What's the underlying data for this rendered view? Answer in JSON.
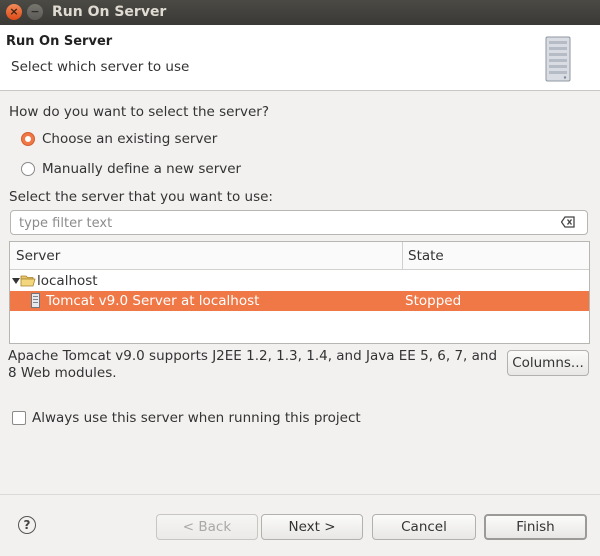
{
  "window": {
    "title": "Run On Server",
    "close_icon": "close-icon",
    "minimize_icon": "minimize-icon"
  },
  "header": {
    "title": "Run On Server",
    "subtitle": "Select which server to use",
    "icon": "server-tower-icon"
  },
  "selection": {
    "question": "How do you want to select the server?",
    "options": [
      {
        "label": "Choose an existing server",
        "selected": true
      },
      {
        "label": "Manually define a new server",
        "selected": false
      }
    ]
  },
  "server_list": {
    "label": "Select the server that you want to use:",
    "filter": {
      "value": "",
      "placeholder": "type filter text"
    },
    "columns": [
      "Server",
      "State"
    ],
    "groups": [
      {
        "name": "localhost",
        "expanded": true,
        "servers": [
          {
            "name": "Tomcat v9.0 Server at localhost",
            "state": "Stopped",
            "selected": true
          }
        ]
      }
    ]
  },
  "description": "Apache Tomcat v9.0 supports J2EE 1.2, 1.3, 1.4, and Java EE 5, 6, 7, and 8 Web modules.",
  "columns_button": "Columns...",
  "always_use": {
    "label": "Always use this server when running this project",
    "checked": false
  },
  "footer": {
    "help_icon": "help-icon",
    "back_label": "< Back",
    "next_label": "Next >",
    "cancel_label": "Cancel",
    "finish_label": "Finish"
  },
  "colors": {
    "accent": "#f07746",
    "titlebar": "#3c3b37",
    "background": "#f2f1f0"
  }
}
